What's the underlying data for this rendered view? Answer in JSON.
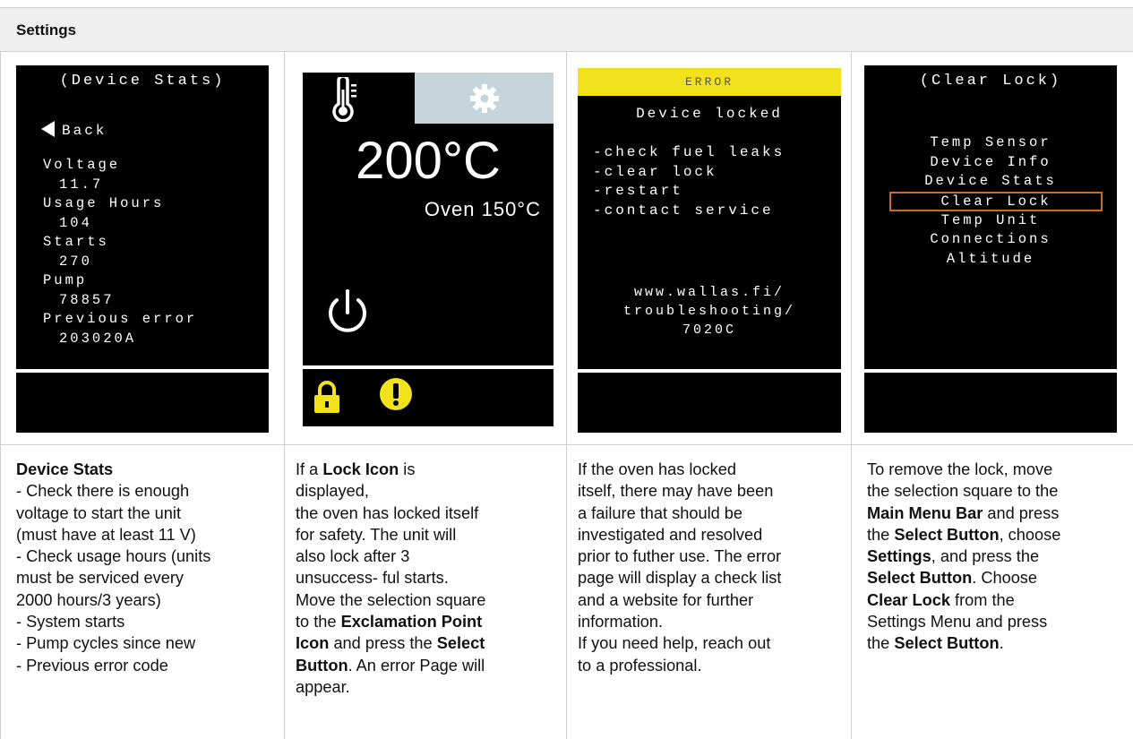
{
  "header": {
    "title": "Settings"
  },
  "screen1": {
    "title": "(Device Stats)",
    "back": "Back",
    "rows": [
      {
        "label": "Voltage",
        "value": "11.7"
      },
      {
        "label": "Usage Hours",
        "value": "104"
      },
      {
        "label": "Starts",
        "value": "270"
      },
      {
        "label": "Pump",
        "value": "78857"
      },
      {
        "label": "Previous error",
        "value": "203020A"
      }
    ]
  },
  "screen2": {
    "temp": "200°C",
    "oven": "Oven 150°C",
    "icons": [
      "thermometer-icon",
      "gear-icon",
      "power-icon",
      "lock-icon",
      "exclamation-icon"
    ],
    "colors": {
      "gear_tab": "#c6d4dc",
      "alert": "#f2e21b"
    }
  },
  "screen3": {
    "banner": "ERROR",
    "title": "Device locked",
    "list": [
      "-check fuel leaks",
      "-clear lock",
      "-restart",
      "-contact service"
    ],
    "url": [
      "www.wallas.fi/",
      "troubleshooting/",
      "7020C"
    ],
    "colors": {
      "banner": "#f2e21b"
    }
  },
  "screen4": {
    "title": "(Clear Lock)",
    "items": [
      "Temp Sensor",
      "Device Info",
      "Device Stats",
      "Clear Lock",
      "Temp Unit",
      "Connections",
      "Altitude"
    ],
    "selected": "Clear Lock",
    "colors": {
      "selection": "#d2691e"
    }
  },
  "col1": {
    "heading": "Device Stats",
    "lines": [
      "- Check there is enough",
      "voltage to start the unit",
      "(must have at least 11 V)",
      "- Check usage hours (units",
      "must be serviced every",
      "2000 hours/3 years)",
      "- System starts",
      "- Pump cycles since new",
      "- Previous error code"
    ]
  },
  "col2": {
    "p1": "If a ",
    "p1b": "Lock Icon",
    "p1c": " is",
    "p2": "displayed,",
    "p3": "the oven has locked itself",
    "p4": "for safety. The unit will",
    "p5": "also lock after 3",
    "p6": "unsuccess- ful starts.",
    "p7": "Move the selection square",
    "p8": "to the ",
    "p8b": "Exclamation Point",
    "p9b": "Icon",
    "p9": " and press the ",
    "p9c": "Select",
    "p10b": "Button",
    "p10": ". An error Page will",
    "p11": "appear."
  },
  "col3": {
    "lines": [
      "If the oven has locked",
      "itself, there may have been",
      "a failure that should be",
      "investigated and resolved",
      "prior to futher use. The error",
      "page will display a check list",
      "and a website for further",
      "information.",
      "If you need help, reach out",
      "to a professional."
    ]
  },
  "col4": {
    "l1": "To remove the lock, move",
    "l2": "the selection square to the",
    "l3b": "Main Menu Bar",
    "l3": " and press",
    "l4": "the ",
    "l4b": "Select Button",
    "l4c": ", choose",
    "l5b": "Settings",
    "l5": ", and press the",
    "l6b": "Select Button",
    "l6": ". Choose",
    "l7b": "Clear Lock",
    "l7": " from the",
    "l8": "Settings Menu and press",
    "l9": "the ",
    "l9b": "Select Button",
    "l9c": "."
  }
}
